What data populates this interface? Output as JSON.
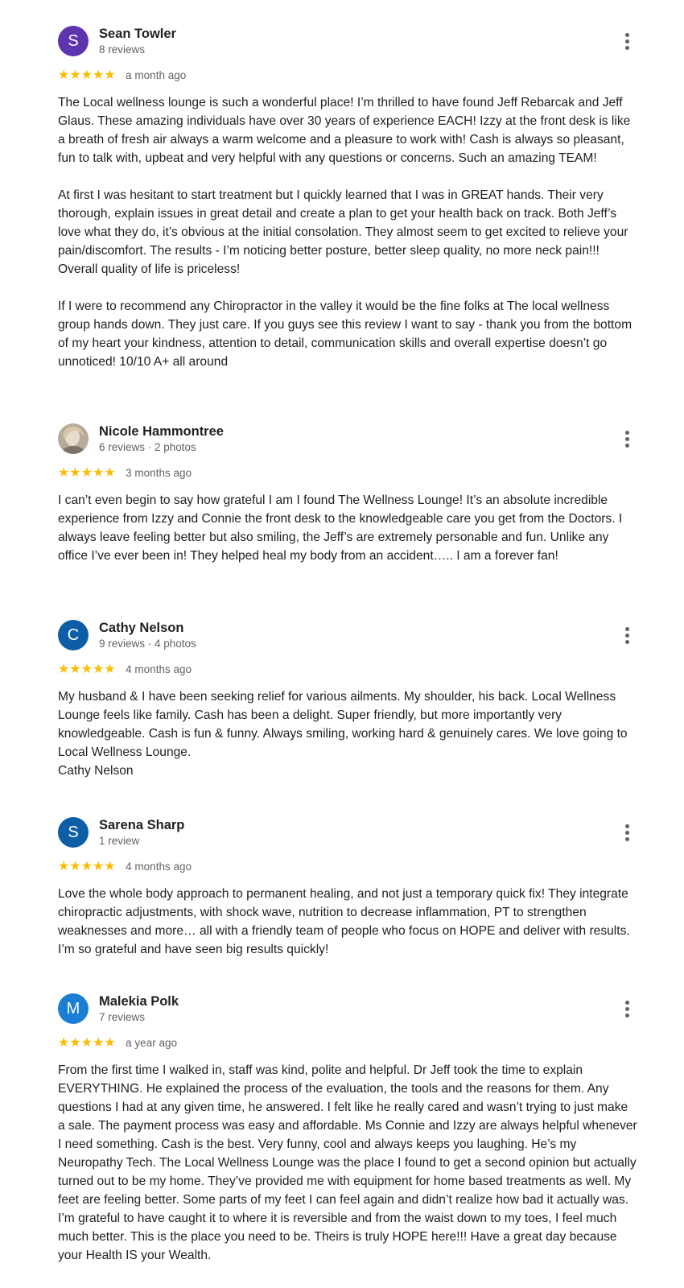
{
  "reviews": [
    {
      "name": "Sean Towler",
      "meta": "8 reviews",
      "avatar_letter": "S",
      "avatar_color": "#5e35b1",
      "stars": "★★★★★",
      "date": "a month ago",
      "paragraphs": [
        "The Local wellness lounge is such a wonderful place! I’m thrilled to have found Jeff Rebarcak and Jeff Glaus. These amazing individuals have over 30 years of experience EACH! Izzy at the front desk is like a breath of fresh air always a warm welcome and a pleasure to work with! Cash is always so pleasant, fun to talk with, upbeat and very helpful with any questions or concerns. Such an amazing TEAM!",
        "At first I was hesitant to start treatment but I quickly learned that I was in GREAT hands. Their very thorough, explain issues in great detail and create a plan to get your health back on track. Both Jeff’s love what they do, it’s obvious at the initial consolation. They almost seem to get excited to relieve your pain/discomfort. The results - I’m noticing better posture, better sleep quality, no more neck pain!!! Overall quality of life is priceless!",
        "If I were to recommend any Chiropractor in the valley it would be the fine folks at The local wellness group hands down. They just care. If you guys see this review I want to say - thank you from the bottom of my heart your kindness, attention to detail, communication skills and overall expertise doesn’t go unnoticed! 10/10 A+ all around"
      ]
    },
    {
      "name": "Nicole Hammontree",
      "meta": "6 reviews · 2 photos",
      "avatar_letter": "",
      "avatar_color": "",
      "stars": "★★★★★",
      "date": "3 months ago",
      "paragraphs": [
        "I can’t even begin to say how grateful I am I found The Wellness Lounge! It’s an absolute incredible experience from Izzy and Connie the front desk to the knowledgeable care you get from the Doctors. I always leave feeling better but also smiling, the Jeff’s are extremely personable and fun. Unlike any office I’ve ever been in! They helped heal my body from an accident….. I am a forever fan!"
      ]
    },
    {
      "name": "Cathy Nelson",
      "meta": "9 reviews · 4 photos",
      "avatar_letter": "C",
      "avatar_color": "#0d5ea6",
      "stars": "★★★★★",
      "date": "4 months ago",
      "paragraphs": [
        "My husband & I have been seeking relief for various ailments. My shoulder, his back. Local Wellness Lounge feels like family. Cash has been a delight. Super friendly, but more importantly very knowledgeable. Cash is fun & funny. Always smiling, working hard & genuinely cares. We love going to Local Wellness Lounge.\nCathy Nelson"
      ]
    },
    {
      "name": "Sarena Sharp",
      "meta": "1 review",
      "avatar_letter": "S",
      "avatar_color": "#0d5ea6",
      "stars": "★★★★★",
      "date": "4 months ago",
      "paragraphs": [
        "Love the whole body approach to permanent healing, and not just a temporary quick fix! They integrate chiropractic adjustments, with shock wave, nutrition to decrease inflammation, PT to strengthen weaknesses and more… all with a friendly team of people who focus on HOPE and deliver with results. I’m so grateful and have seen big results quickly!"
      ]
    },
    {
      "name": "Malekia Polk",
      "meta": "7 reviews",
      "avatar_letter": "M",
      "avatar_color": "#1a7fd4",
      "stars": "★★★★★",
      "date": "a year ago",
      "paragraphs": [
        "From the first time I walked in, staff was kind, polite and helpful. Dr Jeff took the time to explain EVERYTHING. He explained the process of the evaluation, the tools and the reasons for them. Any questions I had at any given time, he answered. I felt like he really cared and wasn’t trying to just make a sale. The payment process was easy and affordable. Ms Connie and Izzy are always helpful whenever I need something. Cash is the best. Very funny, cool and always keeps you laughing. He’s my Neuropathy Tech. The Local Wellness Lounge was the place I found to get a second opinion but actually turned out to be my home. They’ve provided me with equipment for home based treatments as well. My feet are feeling better. Some parts of my feet I can feel again and didn’t realize how bad it actually was. I’m grateful to have caught it to where it is reversible and from the waist down to my toes, I feel much much better. This is the place you need to be. Theirs is truly HOPE here!!! Have a great day because your Health IS your Wealth."
      ]
    }
  ]
}
